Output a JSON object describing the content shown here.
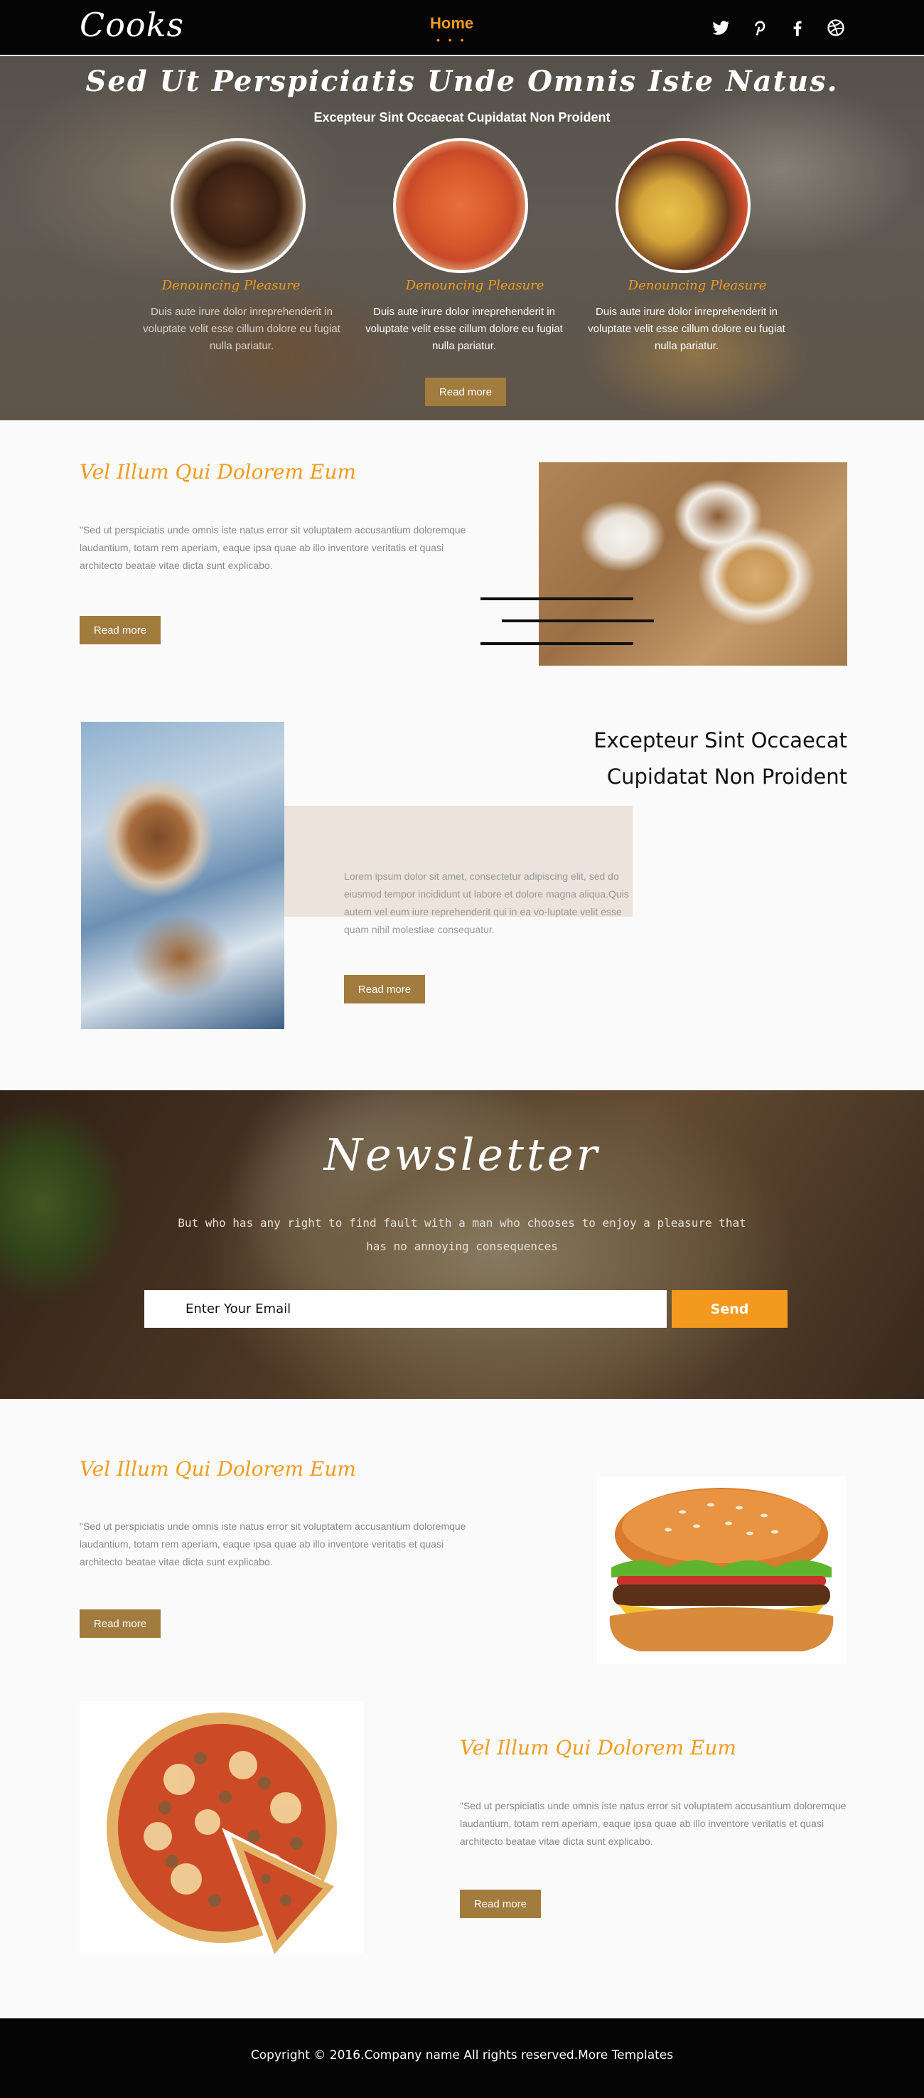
{
  "header": {
    "logo": "Cooks",
    "nav_home": "Home",
    "nav_indicator": "• • •",
    "social": [
      "twitter-icon",
      "pinterest-icon",
      "facebook-icon",
      "dribbble-icon"
    ]
  },
  "hero": {
    "title": "Sed Ut Perspiciatis Unde Omnis Iste Natus.",
    "subtitle": "Excepteur Sint Occaecat Cupidatat Non Proident",
    "features": [
      {
        "image": "grilled-meat",
        "title": "Denouncing Pleasure",
        "text": "Duis aute irure dolor inreprehenderit in voluptate velit esse cillum dolore eu fugiat nulla pariatur."
      },
      {
        "image": "shrimp-dish",
        "title": "Denouncing Pleasure",
        "text": "Duis aute irure dolor inreprehenderit in voluptate velit esse cillum dolore eu fugiat nulla pariatur."
      },
      {
        "image": "plated-dish",
        "title": "Denouncing Pleasure",
        "text": "Duis aute irure dolor inreprehenderit in voluptate velit esse cillum dolore eu fugiat nulla pariatur."
      }
    ],
    "read_more": "Read more"
  },
  "section_nuts": {
    "title": "Vel Illum Qui Dolorem Eum",
    "text": "\"Sed ut perspiciatis unde omnis iste natus error sit voluptatem accusantium doloremque laudantium, totam rem aperiam, eaque ipsa quae ab illo inventore veritatis et quasi architecto beatae vitae dicta sunt explicabo.",
    "read_more": "Read more"
  },
  "section_walnut": {
    "heading_line1": "Excepteur Sint Occaecat",
    "heading_line2": "Cupidatat Non Proident",
    "text": "Lorem ipsum dolor sit amet, consectetur adipiscing elit, sed do eiusmod tempor incididunt ut labore et dolore magna aliqua.Quis autem vel eum iure reprehenderit qui in ea vo-luptate velit esse quam nihil molestiae consequatur.",
    "read_more": "Read more"
  },
  "newsletter": {
    "title": "Newsletter",
    "text": "But who has any right to find fault with a man who chooses to enjoy a pleasure that has no annoying consequences",
    "email_placeholder": "Enter Your Email",
    "send_label": "Send"
  },
  "section_burger": {
    "title": "Vel Illum Qui Dolorem Eum",
    "text": "\"Sed ut perspiciatis unde omnis iste natus error sit voluptatem accusantium doloremque laudantium, totam rem aperiam, eaque ipsa quae ab illo inventore veritatis et quasi architecto beatae vitae dicta sunt explicabo.",
    "read_more": "Read more"
  },
  "section_pizza": {
    "title": "Vel Illum Qui Dolorem Eum",
    "text": "\"Sed ut perspiciatis unde omnis iste natus error sit voluptatem accusantium doloremque laudantium, totam rem aperiam, eaque ipsa quae ab illo inventore veritatis et quasi architecto beatae vitae dicta sunt explicabo.",
    "read_more": "Read more"
  },
  "footer": {
    "copyright": "Copyright © 2016.Company name All rights reserved.More Templates"
  },
  "colors": {
    "accent": "#f39a1e",
    "button": "#a27b3f",
    "header_bg": "#050505",
    "beige_block": "#ebe3dc"
  }
}
